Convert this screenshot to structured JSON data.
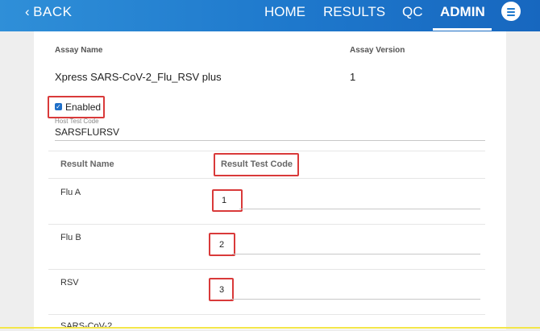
{
  "header": {
    "back_label": "BACK",
    "nav": [
      "HOME",
      "RESULTS",
      "QC",
      "ADMIN"
    ],
    "active_nav": "ADMIN"
  },
  "assay": {
    "name_label": "Assay Name",
    "version_label": "Assay Version",
    "name": "Xpress SARS-CoV-2_Flu_RSV plus",
    "version": "1",
    "enabled_label": "Enabled",
    "enabled": true,
    "host_test_code_label": "Host Test Code",
    "host_test_code": "SARSFLURSV"
  },
  "table": {
    "col_result_name": "Result Name",
    "col_result_test_code": "Result Test Code",
    "rows": [
      {
        "name": "Flu A",
        "code": "1"
      },
      {
        "name": "Flu B",
        "code": "2"
      },
      {
        "name": "RSV",
        "code": "3"
      },
      {
        "name": "SARS-CoV-2",
        "code": ""
      }
    ]
  },
  "colors": {
    "header_blue": "#1e78cc",
    "highlight_red": "#d93a3a",
    "checkbox_blue": "#1e6fc8"
  },
  "icons": {
    "back": "chevron-left-icon",
    "menu": "hamburger-menu-icon",
    "checkbox": "checkbox-checked-icon"
  }
}
